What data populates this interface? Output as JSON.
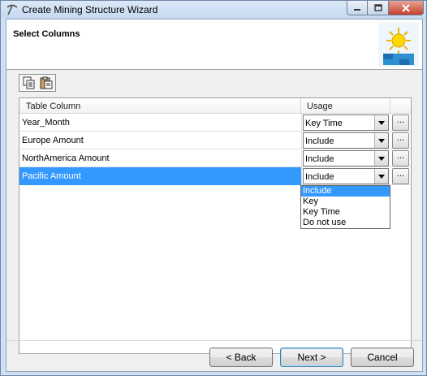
{
  "window": {
    "title": "Create Mining Structure Wizard"
  },
  "header": {
    "title": "Select Columns"
  },
  "toolbar": {
    "items": [
      {
        "icon": "copy-icon"
      },
      {
        "icon": "paste-icon"
      }
    ]
  },
  "grid": {
    "columns": [
      "Table Column",
      "Usage"
    ],
    "rows": [
      {
        "name": "Year_Month",
        "usage": "Key Time",
        "selected": false
      },
      {
        "name": "Europe Amount",
        "usage": "Include",
        "selected": false
      },
      {
        "name": "NorthAmerica Amount",
        "usage": "Include",
        "selected": false
      },
      {
        "name": "Pacific Amount",
        "usage": "Include",
        "selected": true
      }
    ],
    "ellipsis_label": "..."
  },
  "usage_dropdown": {
    "options": [
      "Include",
      "Key",
      "Key Time",
      "Do not use"
    ],
    "highlighted": "Include"
  },
  "buttons": {
    "back": "< Back",
    "next": "Next >",
    "cancel": "Cancel"
  },
  "colors": {
    "selection": "#3399ff",
    "title_bar": "#c6d9f1"
  }
}
